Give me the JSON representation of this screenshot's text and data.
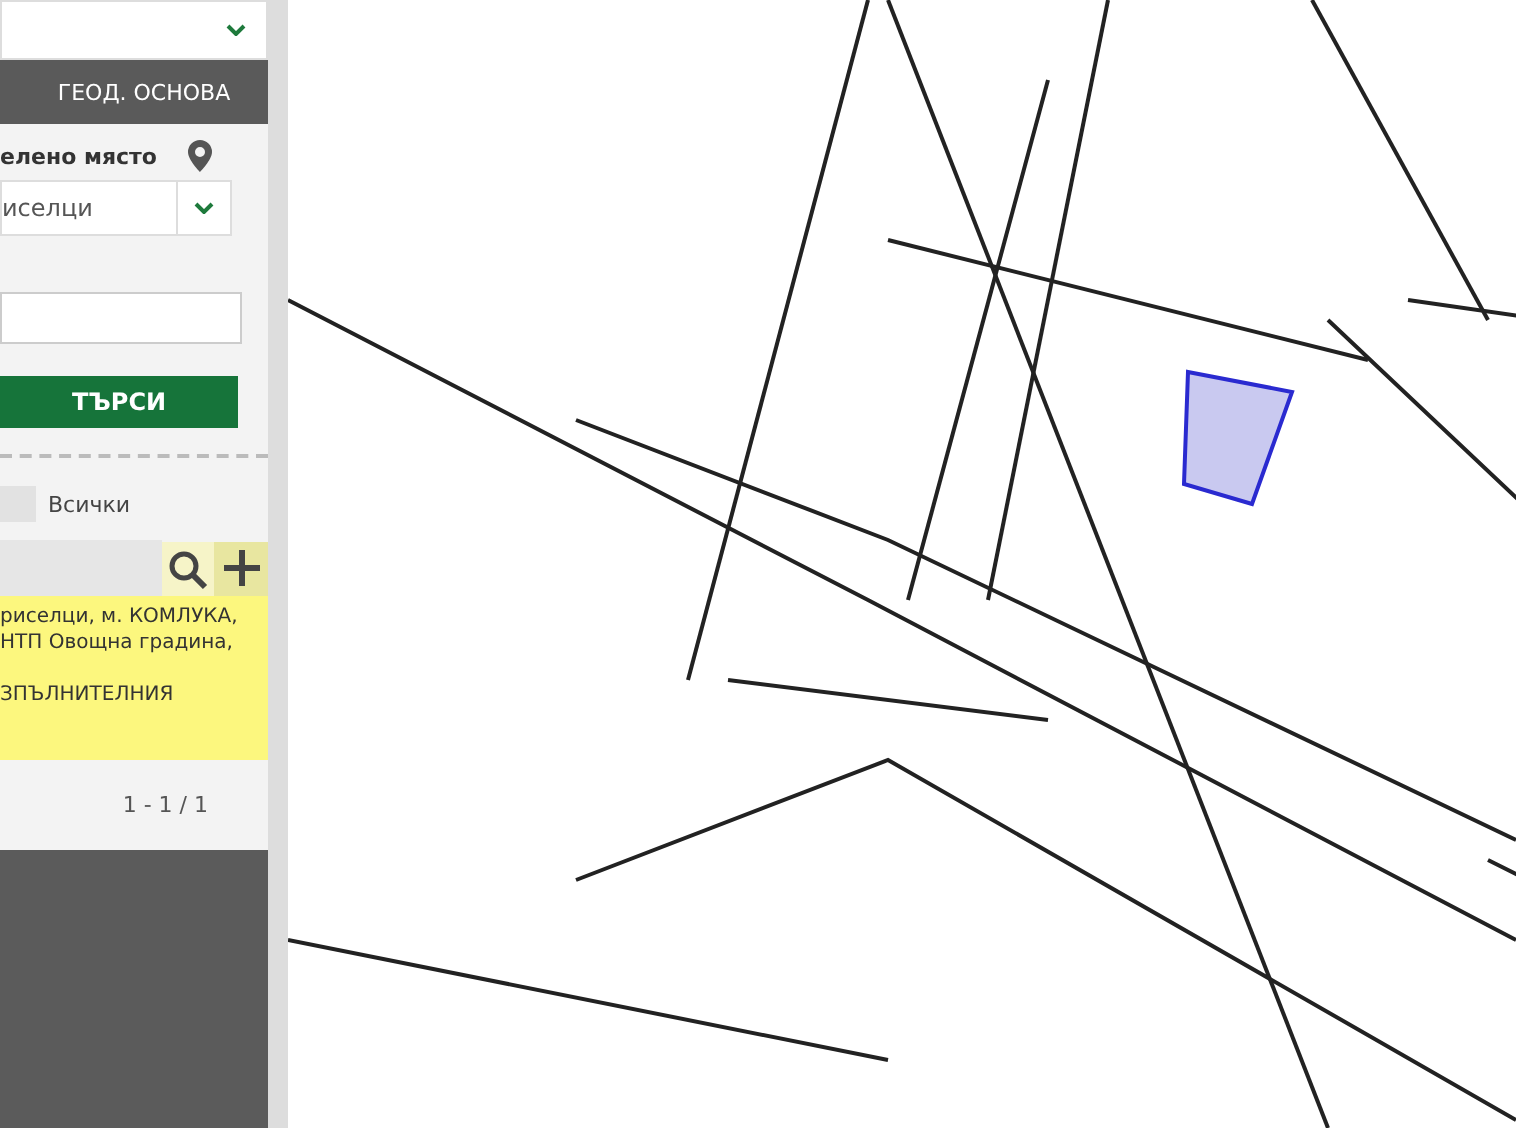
{
  "sidebar": {
    "section_title": "ГЕОД. ОСНОВА",
    "place_label": "елено място",
    "place_select": {
      "value": "исeлци"
    },
    "search_button": "ТЪРСИ",
    "all_checkbox": {
      "label": "Всички",
      "checked": false
    },
    "results": [
      {
        "lines": [
          "рисeлци, м. КОМЛУКА,",
          "НТП Овощна градина,",
          "ЗПЪЛНИТЕЛНИЯ"
        ],
        "selected": true
      }
    ],
    "pagination": "1 - 1 / 1"
  }
}
